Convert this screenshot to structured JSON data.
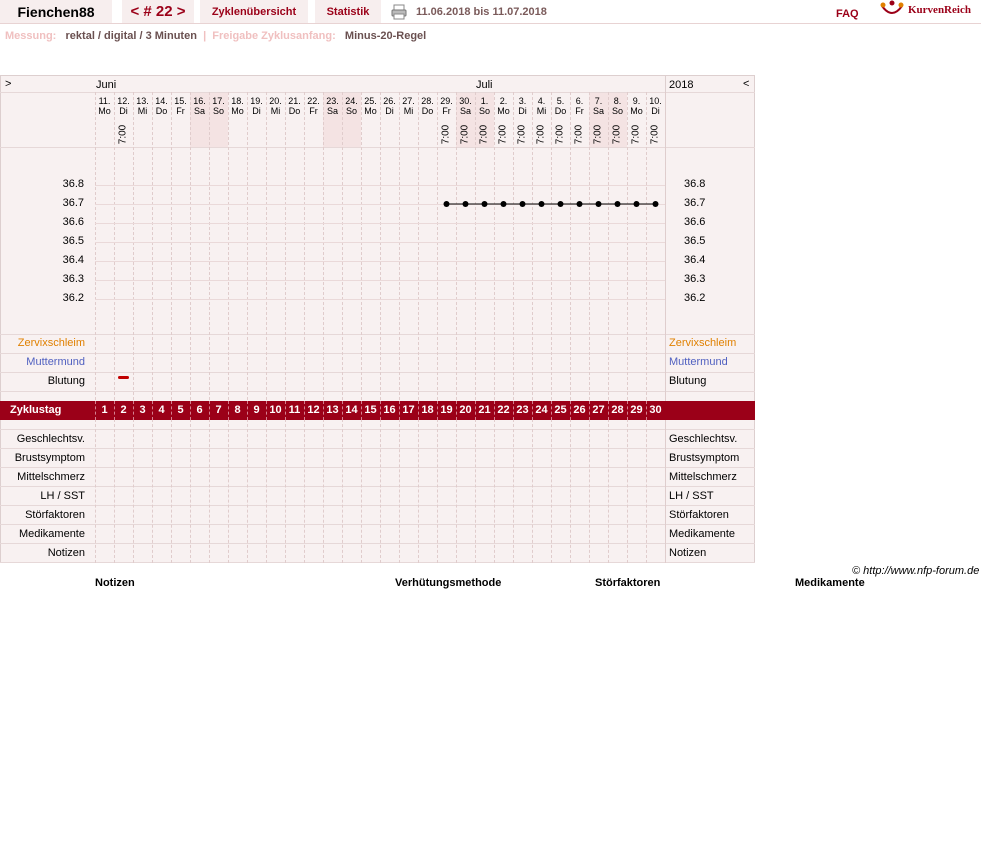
{
  "header": {
    "username": "Fienchen88",
    "cycle_nav": "< # 22 >",
    "tabs": [
      "Zyklenübersicht",
      "Statistik"
    ],
    "date_range": "11.06.2018 bis 11.07.2018",
    "faq": "FAQ",
    "logo": "KurvenReich"
  },
  "info": {
    "measure_label": "Messung:",
    "measure_value": "rektal / digital / 3 Minuten",
    "sep": "|",
    "release_label": "Freigabe Zyklusanfang:",
    "release_value": "Minus-20-Regel"
  },
  "chart": {
    "nav_prev": ">",
    "nav_next": "<",
    "month_1": "Juni",
    "month_2": "Juli",
    "year": "2018",
    "dates": [
      "11.",
      "12.",
      "13.",
      "14.",
      "15.",
      "16.",
      "17.",
      "18.",
      "19.",
      "20.",
      "21.",
      "22.",
      "23.",
      "24.",
      "25.",
      "26.",
      "27.",
      "28.",
      "29.",
      "30.",
      "1.",
      "2.",
      "3.",
      "4.",
      "5.",
      "6.",
      "7.",
      "8.",
      "9.",
      "10."
    ],
    "weekdays": [
      "Mo",
      "Di",
      "Mi",
      "Do",
      "Fr",
      "Sa",
      "So",
      "Mo",
      "Di",
      "Mi",
      "Do",
      "Fr",
      "Sa",
      "So",
      "Mo",
      "Di",
      "Mi",
      "Do",
      "Fr",
      "Sa",
      "So",
      "Mo",
      "Di",
      "Mi",
      "Do",
      "Fr",
      "Sa",
      "So",
      "Mo",
      "Di"
    ],
    "weekend_flags": [
      0,
      0,
      0,
      0,
      0,
      1,
      1,
      0,
      0,
      0,
      0,
      0,
      1,
      1,
      0,
      0,
      0,
      0,
      0,
      1,
      1,
      0,
      0,
      0,
      0,
      0,
      1,
      1,
      0,
      0
    ],
    "times": [
      "",
      "7:00",
      "",
      "",
      "",
      "",
      "",
      "",
      "",
      "",
      "",
      "",
      "",
      "",
      "",
      "",
      "",
      "",
      "7:00",
      "7:00",
      "7:00",
      "7:00",
      "7:00",
      "7:00",
      "7:00",
      "7:00",
      "7:00",
      "7:00",
      "7:00",
      "7:00"
    ],
    "temp_ticks": [
      "36.8",
      "36.7",
      "36.6",
      "36.5",
      "36.4",
      "36.3",
      "36.2"
    ],
    "temps": [
      null,
      null,
      null,
      null,
      null,
      null,
      null,
      null,
      null,
      null,
      null,
      null,
      null,
      null,
      null,
      null,
      null,
      null,
      36.7,
      36.7,
      36.7,
      36.7,
      36.7,
      36.7,
      36.7,
      36.7,
      36.7,
      36.7,
      36.7,
      36.7
    ],
    "row_labels": {
      "zervix": "Zervixschleim",
      "muttermund": "Muttermund",
      "blutung": "Blutung"
    },
    "colors": {
      "zervix": "#e08000",
      "muttermund": "#5060c0",
      "accent": "#9b0018",
      "bleeding": "#c00000"
    },
    "bleeding_days": [
      2
    ],
    "cycle_label": "Zyklustag",
    "cycle_days": [
      "1",
      "2",
      "3",
      "4",
      "5",
      "6",
      "7",
      "8",
      "9",
      "10",
      "11",
      "12",
      "13",
      "14",
      "15",
      "16",
      "17",
      "18",
      "19",
      "20",
      "21",
      "22",
      "23",
      "24",
      "25",
      "26",
      "27",
      "28",
      "29",
      "30"
    ],
    "bottom_rows": [
      "Geschlechtsv.",
      "Brustsymptom",
      "Mittelschmerz",
      "LH / SST",
      "Störfaktoren",
      "Medikamente",
      "Notizen"
    ]
  },
  "copyright": "© http://www.nfp-forum.de",
  "footer": [
    "Notizen",
    "Verhütungsmethode",
    "Störfaktoren",
    "Medikamente"
  ]
}
